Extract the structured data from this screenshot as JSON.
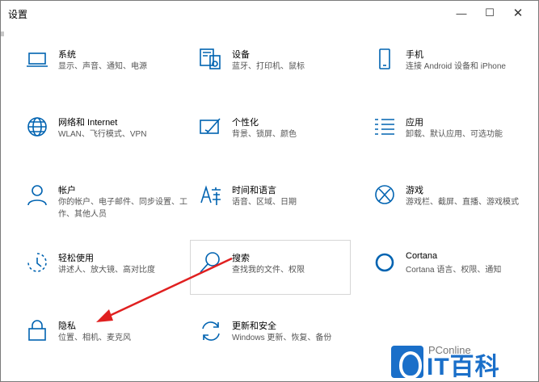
{
  "window": {
    "title": "设置",
    "minimize": "—",
    "maximize": "☐",
    "close": "✕"
  },
  "tiles": [
    {
      "name": "系统",
      "desc": "显示、声音、通知、电源",
      "icon": "laptop-icon"
    },
    {
      "name": "设备",
      "desc": "蓝牙、打印机、鼠标",
      "icon": "devices-icon"
    },
    {
      "name": "手机",
      "desc": "连接 Android 设备和 iPhone",
      "icon": "phone-icon"
    },
    {
      "name": "网络和 Internet",
      "desc": "WLAN、飞行模式、VPN",
      "icon": "globe-icon"
    },
    {
      "name": "个性化",
      "desc": "背景、锁屏、颜色",
      "icon": "paintbrush-icon"
    },
    {
      "name": "应用",
      "desc": "卸载、默认应用、可选功能",
      "icon": "apps-list-icon"
    },
    {
      "name": "帐户",
      "desc": "你的帐户、电子邮件、同步设置、工作、其他人员",
      "icon": "person-icon"
    },
    {
      "name": "时间和语言",
      "desc": "语音、区域、日期",
      "icon": "time-language-icon"
    },
    {
      "name": "游戏",
      "desc": "游戏栏、截屏、直播、游戏模式",
      "icon": "xbox-icon"
    },
    {
      "name": "轻松使用",
      "desc": "讲述人、放大镜、高对比度",
      "icon": "ease-of-access-icon"
    },
    {
      "name": "搜索",
      "desc": "查找我的文件、权限",
      "icon": "search-icon"
    },
    {
      "name": "Cortana",
      "desc": "Cortana 语言、权限、通知",
      "icon": "cortana-icon"
    },
    {
      "name": "隐私",
      "desc": "位置、相机、麦克风",
      "icon": "lock-icon"
    },
    {
      "name": "更新和安全",
      "desc": "Windows 更新、恢复、备份",
      "icon": "update-icon"
    }
  ],
  "watermark": {
    "small": "PConline",
    "big": "IT百科"
  },
  "colors": {
    "accent": "#0063b1",
    "arrow": "#e02020"
  }
}
